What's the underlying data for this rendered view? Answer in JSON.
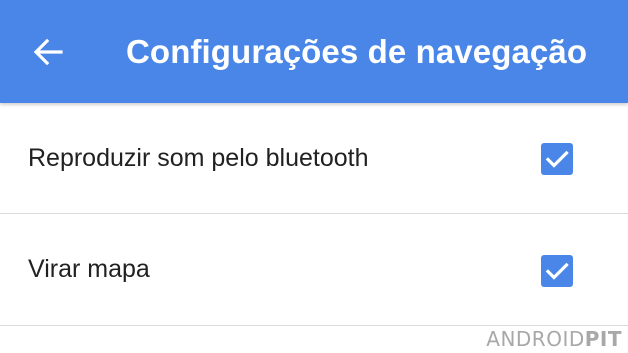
{
  "app_bar": {
    "title": "Configurações de navegação",
    "back_icon": "arrow-back-icon",
    "background_color": "#4a86e8"
  },
  "settings": [
    {
      "label": "Reproduzir som pelo bluetooth",
      "checked": true
    },
    {
      "label": "Virar mapa",
      "checked": true
    }
  ],
  "checkbox_color": "#4a86e8",
  "watermark": {
    "part1": "ANDROID",
    "part2": "PIT"
  }
}
